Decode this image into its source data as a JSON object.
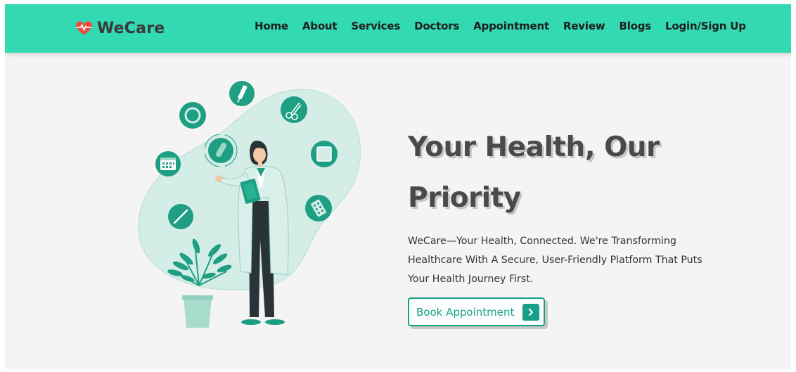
{
  "colors": {
    "brand": "#33d9b2",
    "accent": "#16a085",
    "heart": "#e74c3c",
    "text_dark": "#4a4a4a"
  },
  "header": {
    "brand_name": "WeCare",
    "logo_icon": "heart-pulse-icon",
    "nav": [
      {
        "label": "Home"
      },
      {
        "label": "About"
      },
      {
        "label": "Services"
      },
      {
        "label": "Doctors"
      },
      {
        "label": "Appointment"
      },
      {
        "label": "Review"
      },
      {
        "label": "Blogs"
      },
      {
        "label": "Login/Sign Up"
      }
    ]
  },
  "hero": {
    "title_line1": "Your Health, Our",
    "title_line2": "Priority",
    "description": "WeCare—Your Health, Connected. We're Transforming Healthcare With A Secure, User-Friendly Platform That Puts Your Health Journey First.",
    "cta_label": "Book Appointment",
    "cta_icon": "chevron-right-icon"
  },
  "illustration": {
    "name": "doctor-illustration",
    "icons": [
      "pill-icon",
      "syringe-icon",
      "scissors-icon",
      "calendar-icon",
      "test-tube-icon",
      "bandage-icon",
      "thermometer-icon",
      "pill-pack-icon"
    ]
  }
}
